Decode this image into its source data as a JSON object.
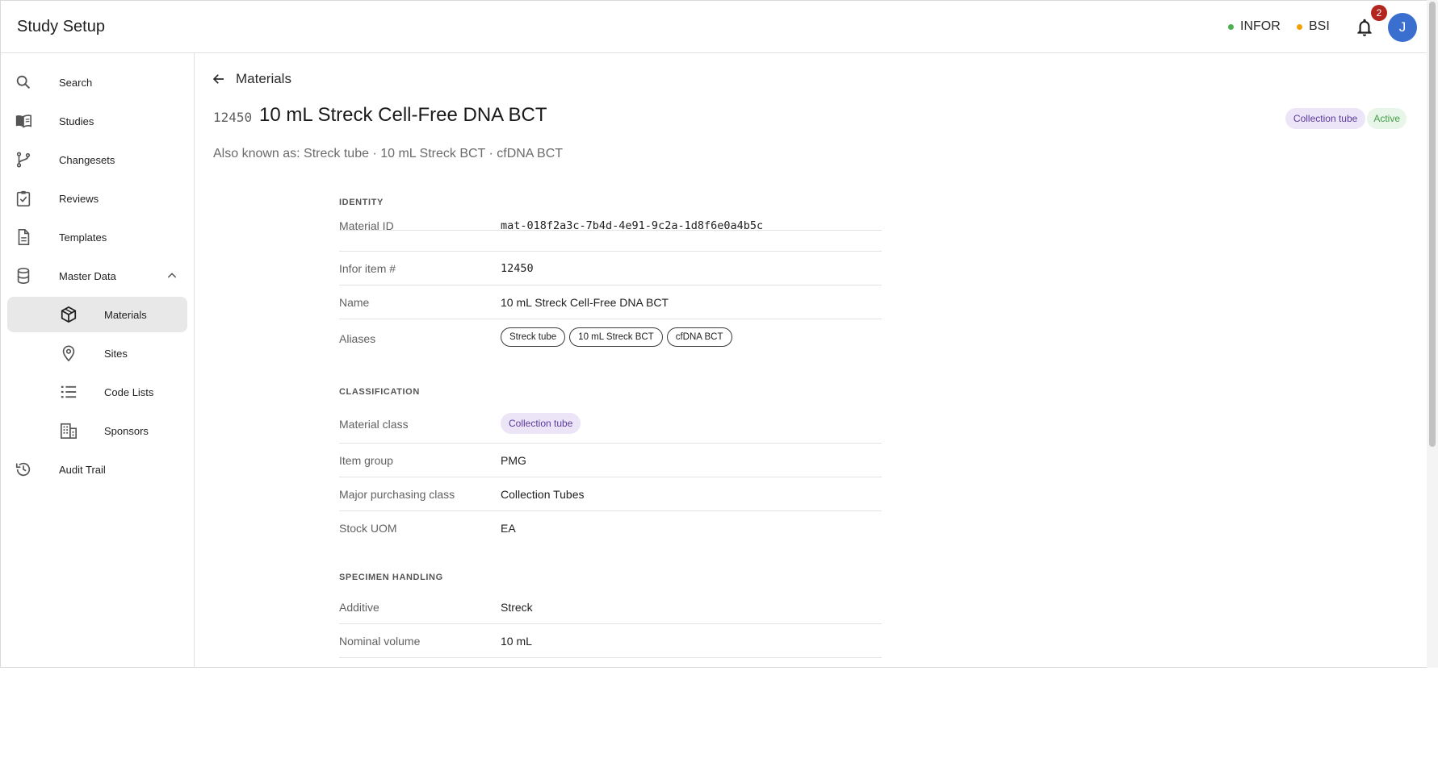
{
  "header": {
    "title": "Study Setup",
    "systems": [
      {
        "label": "INFOR",
        "color": "#4caf50"
      },
      {
        "label": "BSI",
        "color": "#f5a000"
      }
    ],
    "notification_count": "2",
    "avatar_initial": "J"
  },
  "sidebar": {
    "items": [
      {
        "label": "Search",
        "icon": "search-icon"
      },
      {
        "label": "Studies",
        "icon": "book-icon"
      },
      {
        "label": "Changesets",
        "icon": "branch-icon"
      },
      {
        "label": "Reviews",
        "icon": "clipboard-check-icon"
      },
      {
        "label": "Templates",
        "icon": "document-icon"
      },
      {
        "label": "Master Data",
        "icon": "database-icon",
        "expanded": true
      },
      {
        "label": "Materials",
        "icon": "cube-icon",
        "active": true
      },
      {
        "label": "Sites",
        "icon": "location-pin-icon"
      },
      {
        "label": "Code Lists",
        "icon": "list-icon"
      },
      {
        "label": "Sponsors",
        "icon": "building-icon"
      },
      {
        "label": "Audit Trail",
        "icon": "history-icon"
      }
    ]
  },
  "main": {
    "back_label": "Materials",
    "item_number": "12450",
    "title": "10 mL Streck Cell-Free DNA BCT",
    "also_known_as": "Also known as: Streck tube · 10 mL Streck BCT · cfDNA BCT",
    "header_chips": {
      "class": "Collection tube",
      "status": "Active"
    },
    "sections": {
      "identity": {
        "heading": "IDENTITY",
        "material_id": {
          "label": "Material ID",
          "value": "mat-018f2a3c-7b4d-4e91-9c2a-1d8f6e0a4b5c"
        },
        "infor_item": {
          "label": "Infor item #",
          "value": "12450"
        },
        "name": {
          "label": "Name",
          "value": "10 mL Streck Cell-Free DNA BCT"
        },
        "aliases": {
          "label": "Aliases",
          "values": [
            "Streck tube",
            "10 mL Streck BCT",
            "cfDNA BCT"
          ]
        }
      },
      "classification": {
        "heading": "CLASSIFICATION",
        "material_class": {
          "label": "Material class",
          "value": "Collection tube"
        },
        "item_group": {
          "label": "Item group",
          "value": "PMG"
        },
        "major_purchasing_class": {
          "label": "Major purchasing class",
          "value": "Collection Tubes"
        },
        "stock_uom": {
          "label": "Stock UOM",
          "value": "EA"
        }
      },
      "specimen_handling": {
        "heading": "SPECIMEN HANDLING",
        "additive": {
          "label": "Additive",
          "value": "Streck"
        },
        "nominal_volume": {
          "label": "Nominal volume",
          "value": "10 mL"
        }
      }
    }
  },
  "colors": {
    "accent_purple_bg": "#ece4f7",
    "accent_purple_fg": "#5b3b9a",
    "active_green": "#43a047",
    "notification_red": "#b3261e",
    "avatar_blue": "#3a6fcf"
  }
}
